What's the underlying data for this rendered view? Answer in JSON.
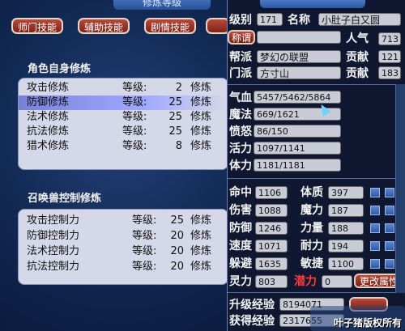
{
  "left_window": {
    "title": "修炼等级",
    "tabs": [
      "师门技能",
      "辅助技能",
      "剧情技能"
    ],
    "self_section": "角色自身修炼",
    "self_rows": [
      {
        "name": "攻击修炼",
        "level_label": "等级:",
        "level": "2",
        "suffix": "修炼"
      },
      {
        "name": "防御修炼",
        "level_label": "等级:",
        "level": "25",
        "suffix": "修炼"
      },
      {
        "name": "法术修炼",
        "level_label": "等级:",
        "level": "25",
        "suffix": "修炼"
      },
      {
        "name": "抗法修炼",
        "level_label": "等级:",
        "level": "25",
        "suffix": "修炼"
      },
      {
        "name": "猎术修炼",
        "level_label": "等级:",
        "level": "8",
        "suffix": "修炼"
      }
    ],
    "pet_section": "召唤兽控制修炼",
    "pet_rows": [
      {
        "name": "攻击控制力",
        "level_label": "等级:",
        "level": "25",
        "suffix": "修炼"
      },
      {
        "name": "防御控制力",
        "level_label": "等级:",
        "level": "20",
        "suffix": "修炼"
      },
      {
        "name": "法术控制力",
        "level_label": "等级:",
        "level": "20",
        "suffix": "修炼"
      },
      {
        "name": "抗法控制力",
        "level_label": "等级:",
        "level": "20",
        "suffix": "修炼"
      }
    ]
  },
  "right_window": {
    "level_label": "级别",
    "level": "171",
    "name_label": "名称",
    "name": "小肚子白又圆",
    "title_button": "称谓",
    "popularity_label": "人气",
    "popularity": "713",
    "gang_label": "帮派",
    "gang": "梦幻の联盟",
    "contrib1_label": "贡献",
    "contrib1": "121",
    "school_label": "门派",
    "school": "方寸山",
    "contrib2_label": "贡献",
    "contrib2": "183",
    "hp_label": "气血",
    "hp": "5457/5462/5864",
    "mp_label": "魔法",
    "mp": "669/1621",
    "anger_label": "愤怒",
    "anger": "86/150",
    "vitality_label": "活力",
    "vitality": "1097/1141",
    "stamina_label": "体力",
    "stamina": "1181/1181",
    "hit_label": "命中",
    "hit": "1106",
    "con_label": "体质",
    "con": "397",
    "dmg_label": "伤害",
    "dmg": "1088",
    "magic_label": "魔力",
    "magic": "187",
    "def_label": "防御",
    "def": "1246",
    "str_label": "力量",
    "str": "188",
    "spd_label": "速度",
    "spd": "1071",
    "end_label": "耐力",
    "end": "194",
    "dodge_label": "躲避",
    "dodge": "1635",
    "agi_label": "敏捷",
    "agi": "1100",
    "spirit_label": "灵力",
    "spirit": "803",
    "potential_label": "潜力",
    "potential": "0",
    "change_button": "更改属性",
    "up_exp_label": "升级经验",
    "up_exp": "8194071",
    "got_exp_label": "获得经验",
    "got_exp": "2317655"
  },
  "watermark": "叶子猪版权所有",
  "colors": {
    "tab_red": "#9a3328",
    "panel": "#d5d8e8",
    "bg": "#0f1830"
  }
}
